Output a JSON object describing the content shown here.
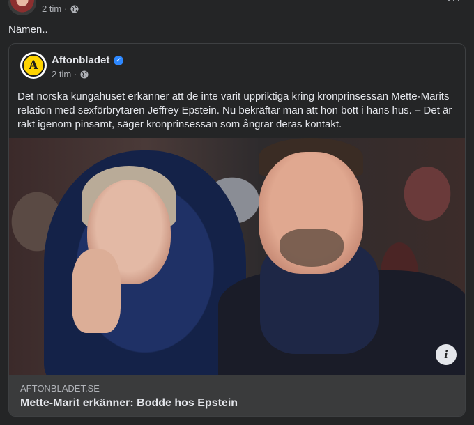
{
  "post": {
    "time": "2 tim",
    "separator": "·",
    "more_label": "···",
    "text": "Nämen.."
  },
  "shared": {
    "page_name": "Aftonbladet",
    "logo_letter": "A",
    "verified_mark": "✓",
    "time": "2 tim",
    "separator": "·",
    "text": "Det norska kungahuset erkänner att de inte varit uppriktiga kring kronprinsessan Mette-Marits relation med sexförbrytaren Jeffrey Epstein. Nu bekräftar man att hon bott i hans hus. – Det är rakt igenom pinsamt, säger kronprinsessan som ångrar deras kontakt.",
    "link": {
      "domain": "AFTONBLADET.SE",
      "title": "Mette-Marit erkänner: Bodde hos Epstein",
      "info_label": "i"
    }
  },
  "colors": {
    "background": "#242526",
    "text_primary": "#e4e6eb",
    "text_secondary": "#b0b3b8",
    "verified": "#2d88ff",
    "logo_yellow": "#ffd400"
  }
}
